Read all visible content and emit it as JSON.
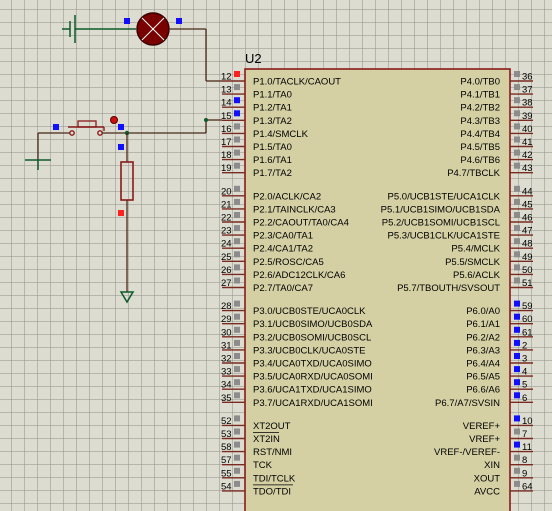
{
  "designator": "U2",
  "colors": {
    "chip_body": "#d4d0a4",
    "chip_border": "#8a1a1a",
    "pin_red": "#ff2020",
    "pin_blue": "#1010ff",
    "pin_grey": "#8c8c8c",
    "wire": "#4a2a1a",
    "ground_wire": "#0f5a2a"
  },
  "left_pins": [
    {
      "num": "12",
      "name": "P1.0/TACLK/CAOUT",
      "state": "red"
    },
    {
      "num": "13",
      "name": "P1.1/TA0",
      "state": "grey"
    },
    {
      "num": "14",
      "name": "P1.2/TA1",
      "state": "blue"
    },
    {
      "num": "15",
      "name": "P1.3/TA2",
      "state": "blue"
    },
    {
      "num": "16",
      "name": "P1.4/SMCLK",
      "state": "grey"
    },
    {
      "num": "17",
      "name": "P1.5/TA0",
      "state": "grey"
    },
    {
      "num": "18",
      "name": "P1.6/TA1",
      "state": "grey"
    },
    {
      "num": "19",
      "name": "P1.7/TA2",
      "state": "grey"
    },
    {
      "num": "20",
      "name": "P2.0/ACLK/CA2",
      "state": "grey"
    },
    {
      "num": "21",
      "name": "P2.1/TAINCLK/CA3",
      "state": "grey"
    },
    {
      "num": "22",
      "name": "P2.2/CAOUT/TA0/CA4",
      "state": "grey"
    },
    {
      "num": "23",
      "name": "P2.3/CA0/TA1",
      "state": "grey"
    },
    {
      "num": "24",
      "name": "P2.4/CA1/TA2",
      "state": "grey"
    },
    {
      "num": "25",
      "name": "P2.5/ROSC/CA5",
      "state": "grey"
    },
    {
      "num": "26",
      "name": "P2.6/ADC12CLK/CA6",
      "state": "grey"
    },
    {
      "num": "27",
      "name": "P2.7/TA0/CA7",
      "state": "grey"
    },
    {
      "num": "28",
      "name": "P3.0/UCB0STE/UCA0CLK",
      "state": "grey"
    },
    {
      "num": "29",
      "name": "P3.1/UCB0SIMO/UCB0SDA",
      "state": "grey"
    },
    {
      "num": "30",
      "name": "P3.2/UCB0SOMI/UCB0SCL",
      "state": "grey"
    },
    {
      "num": "31",
      "name": "P3.3/UCB0CLK/UCA0STE",
      "state": "grey"
    },
    {
      "num": "32",
      "name": "P3.4/UCA0TXD/UCA0SIMO",
      "state": "grey"
    },
    {
      "num": "33",
      "name": "P3.5/UCA0RXD/UCA0SOMI",
      "state": "grey"
    },
    {
      "num": "34",
      "name": "P3.6/UCA1TXD/UCA1SIMO",
      "state": "grey"
    },
    {
      "num": "35",
      "name": "P3.7/UCA1RXD/UCA1SOMI",
      "state": "grey"
    },
    {
      "num": "52",
      "name": "XT2OUT",
      "state": "grey"
    },
    {
      "num": "53",
      "name": "XT2IN",
      "state": "grey"
    },
    {
      "num": "58",
      "name": "RST/NMI",
      "state": "grey"
    },
    {
      "num": "57",
      "name": "TCK",
      "state": "grey"
    },
    {
      "num": "55",
      "name": "TDI/TCLK",
      "state": "grey"
    },
    {
      "num": "54",
      "name": "TDO/TDI",
      "state": "grey"
    }
  ],
  "right_pins": [
    {
      "num": "36",
      "name": "P4.0/TB0",
      "state": "grey"
    },
    {
      "num": "37",
      "name": "P4.1/TB1",
      "state": "grey"
    },
    {
      "num": "38",
      "name": "P4.2/TB2",
      "state": "grey"
    },
    {
      "num": "39",
      "name": "P4.3/TB3",
      "state": "grey"
    },
    {
      "num": "40",
      "name": "P4.4/TB4",
      "state": "grey"
    },
    {
      "num": "41",
      "name": "P4.5/TB5",
      "state": "grey"
    },
    {
      "num": "42",
      "name": "P4.6/TB6",
      "state": "grey"
    },
    {
      "num": "43",
      "name": "P4.7/TBCLK",
      "state": "grey"
    },
    {
      "num": "44",
      "name": "P5.0/UCB1STE/UCA1CLK",
      "state": "grey"
    },
    {
      "num": "45",
      "name": "P5.1/UCB1SIMO/UCB1SDA",
      "state": "grey"
    },
    {
      "num": "46",
      "name": "P5.2/UCB1SOMI/UCB1SCL",
      "state": "grey"
    },
    {
      "num": "47",
      "name": "P5.3/UCB1CLK/UCA1STE",
      "state": "grey"
    },
    {
      "num": "48",
      "name": "P5.4/MCLK",
      "state": "grey"
    },
    {
      "num": "49",
      "name": "P5.5/SMCLK",
      "state": "grey"
    },
    {
      "num": "50",
      "name": "P5.6/ACLK",
      "state": "grey"
    },
    {
      "num": "51",
      "name": "P5.7/TBOUTH/SVSOUT",
      "state": "grey"
    },
    {
      "num": "59",
      "name": "P6.0/A0",
      "state": "blue"
    },
    {
      "num": "60",
      "name": "P6.1/A1",
      "state": "blue"
    },
    {
      "num": "61",
      "name": "P6.2/A2",
      "state": "blue"
    },
    {
      "num": "2",
      "name": "P6.3/A3",
      "state": "blue"
    },
    {
      "num": "3",
      "name": "P6.4/A4",
      "state": "blue"
    },
    {
      "num": "4",
      "name": "P6.5/A5",
      "state": "blue"
    },
    {
      "num": "5",
      "name": "P6.6/A6",
      "state": "blue"
    },
    {
      "num": "6",
      "name": "P6.7/A7/SVSIN",
      "state": "blue"
    },
    {
      "num": "10",
      "name": "VEREF+",
      "state": "blue"
    },
    {
      "num": "7",
      "name": "VREF+",
      "state": "grey"
    },
    {
      "num": "11",
      "name": "VREF-/VEREF-",
      "state": "blue"
    },
    {
      "num": "8",
      "name": "XIN",
      "state": "grey"
    },
    {
      "num": "9",
      "name": "XOUT",
      "state": "grey"
    },
    {
      "num": "64",
      "name": "AVCC",
      "state": "grey"
    }
  ],
  "overlined_pins": [
    "XT2IN",
    "TDO/TDI"
  ]
}
